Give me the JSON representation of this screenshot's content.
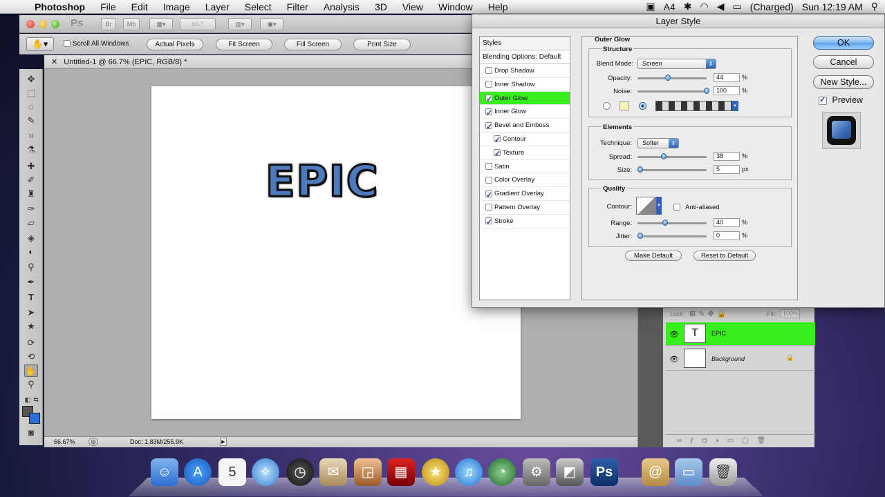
{
  "menubar": {
    "app": "Photoshop",
    "items": [
      "File",
      "Edit",
      "Image",
      "Layer",
      "Select",
      "Filter",
      "Analysis",
      "3D",
      "View",
      "Window",
      "Help"
    ],
    "status": {
      "text_size": "4",
      "battery": "(Charged)",
      "clock": "Sun 12:19 AM"
    }
  },
  "appbar": {
    "logo": "Ps",
    "btn_br": "Br",
    "btn_mb": "Mb",
    "zoom": "66.7"
  },
  "options": {
    "scroll_all": "Scroll All Windows",
    "actual_pixels": "Actual Pixels",
    "fit_screen": "Fit Screen",
    "fill_screen": "Fill Screen",
    "print_size": "Print Size"
  },
  "document": {
    "tab_title": "Untitled-1 @ 66.7% (EPIC, RGB/8) *",
    "canvas_text": "EPIC",
    "zoom": "66.67%",
    "doc_info": "Doc: 1.83M/255.9K"
  },
  "layers": {
    "lock_label": "Lock:",
    "fill_label": "Fill:",
    "fill_value": "100%",
    "rows": [
      {
        "name": "EPIC",
        "thumb": "T"
      },
      {
        "name": "Background",
        "thumb": ""
      }
    ]
  },
  "dialog": {
    "title": "Layer Style",
    "styles_header": "Styles",
    "blending": "Blending Options: Default",
    "styles": [
      {
        "label": "Drop Shadow",
        "checked": false
      },
      {
        "label": "Inner Shadow",
        "checked": false
      },
      {
        "label": "Outer Glow",
        "checked": true
      },
      {
        "label": "Inner Glow",
        "checked": true
      },
      {
        "label": "Bevel and Emboss",
        "checked": true
      },
      {
        "label": "Contour",
        "checked": true
      },
      {
        "label": "Texture",
        "checked": true
      },
      {
        "label": "Satin",
        "checked": false
      },
      {
        "label": "Color Overlay",
        "checked": false
      },
      {
        "label": "Gradient Overlay",
        "checked": true
      },
      {
        "label": "Pattern Overlay",
        "checked": false
      },
      {
        "label": "Stroke",
        "checked": true
      }
    ],
    "section_title": "Outer Glow",
    "structure": {
      "title": "Structure",
      "blend_label": "Blend Mode:",
      "blend_value": "Screen",
      "opacity_label": "Opacity:",
      "opacity": "44",
      "opacity_unit": "%",
      "noise_label": "Noise:",
      "noise": "100",
      "noise_unit": "%"
    },
    "elements": {
      "title": "Elements",
      "technique_label": "Technique:",
      "technique_value": "Softer",
      "spread_label": "Spread:",
      "spread": "38",
      "spread_unit": "%",
      "size_label": "Size:",
      "size": "5",
      "size_unit": "px"
    },
    "quality": {
      "title": "Quality",
      "contour_label": "Contour:",
      "anti_aliased": "Anti-aliased",
      "range_label": "Range:",
      "range": "40",
      "range_unit": "%",
      "jitter_label": "Jitter:",
      "jitter": "0",
      "jitter_unit": "%"
    },
    "make_default": "Make Default",
    "reset_default": "Reset to Default",
    "ok": "OK",
    "cancel": "Cancel",
    "new_style": "New Style...",
    "preview": "Preview"
  },
  "colors": {
    "active_style": "#37ef1c",
    "active_layer": "#37ef1c",
    "swatch_bg": "#2a6fd4"
  }
}
